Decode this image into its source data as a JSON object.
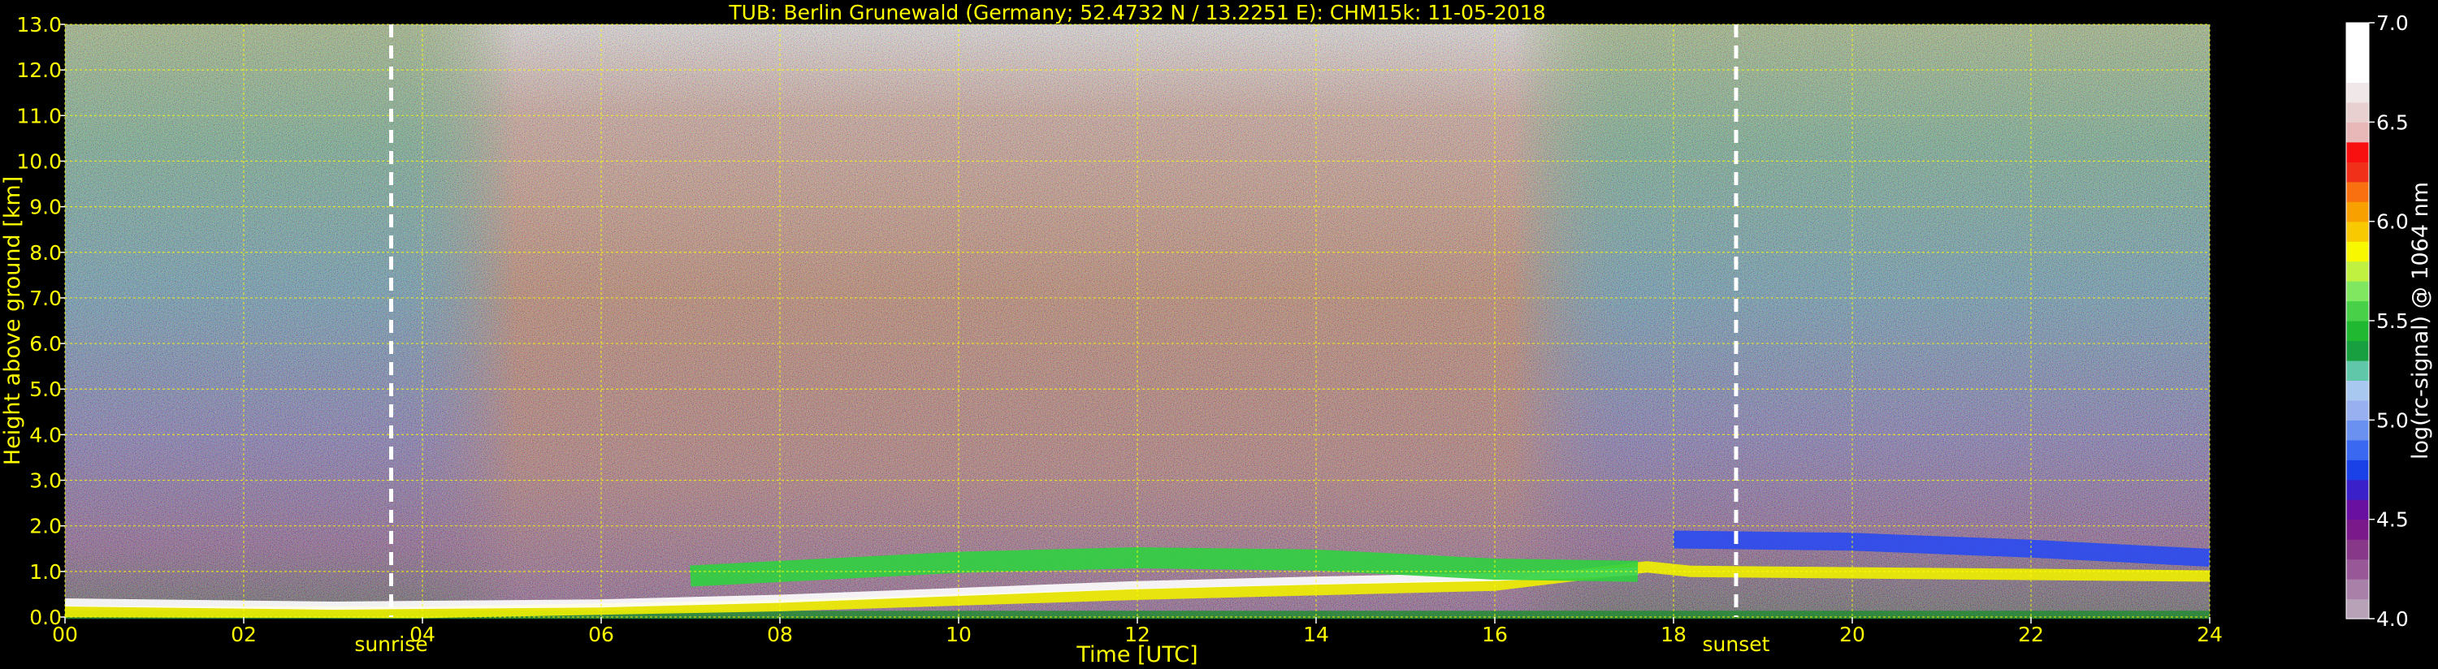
{
  "chart_data": {
    "type": "heatmap",
    "title": "TUB: Berlin Grunewald (Germany; 52.4732 N / 13.2251 E):    CHM15k: 11-05-2018",
    "xlabel": "Time [UTC]",
    "ylabel": "Height above ground [km]",
    "xlim": [
      0,
      24
    ],
    "ylim": [
      0,
      13
    ],
    "x_ticks": [
      "00",
      "02",
      "04",
      "06",
      "08",
      "10",
      "12",
      "14",
      "16",
      "18",
      "20",
      "22",
      "24"
    ],
    "y_ticks": [
      "0.0",
      "1.0",
      "2.0",
      "3.0",
      "4.0",
      "5.0",
      "6.0",
      "7.0",
      "8.0",
      "9.0",
      "10.0",
      "11.0",
      "12.0",
      "13.0"
    ],
    "grid": true,
    "grid_color": "#ffff00",
    "events": [
      {
        "name": "sunrise",
        "time": 3.65
      },
      {
        "name": "sunset",
        "time": 18.7
      }
    ],
    "colorbar": {
      "label": "log(rc-signal) @ 1064 nm",
      "range": [
        4.0,
        7.0
      ],
      "ticks": [
        "4.0",
        "4.5",
        "5.0",
        "5.5",
        "6.0",
        "6.5",
        "7.0"
      ],
      "colors": [
        "#b8a2b8",
        "#a880a8",
        "#985898",
        "#883888",
        "#7a1a8a",
        "#6a10a0",
        "#3a20c8",
        "#1a40e8",
        "#3a68f0",
        "#6a90f0",
        "#98b0f0",
        "#a8c8f0",
        "#60c8a8",
        "#18a040",
        "#20b830",
        "#48d048",
        "#80e860",
        "#c0f040",
        "#f8f800",
        "#f8c800",
        "#f8a000",
        "#f87010",
        "#f03018",
        "#f81010",
        "#e8b8b8",
        "#e8d0d0",
        "#f0e8e8",
        "#ffffff",
        "#ffffff",
        "#ffffff"
      ]
    },
    "layers": [
      {
        "name": "surface",
        "color": "#2a8a3a",
        "points": [
          [
            0,
            0.05
          ],
          [
            24,
            0.05
          ]
        ]
      },
      {
        "name": "aerosol-layer-top",
        "color": "#f0f000",
        "points": [
          [
            0,
            0.12
          ],
          [
            4,
            0.1
          ],
          [
            8,
            0.25
          ],
          [
            12,
            0.5
          ],
          [
            16,
            0.7
          ],
          [
            17.7,
            1.1
          ],
          [
            18.2,
            1.0
          ],
          [
            24,
            0.9
          ]
        ]
      },
      {
        "name": "boundary-layer-top",
        "color": "#ffffff",
        "points": [
          [
            0,
            0.32
          ],
          [
            3,
            0.25
          ],
          [
            6,
            0.3
          ],
          [
            8,
            0.4
          ],
          [
            10,
            0.55
          ],
          [
            12,
            0.7
          ],
          [
            14,
            0.8
          ],
          [
            16,
            0.88
          ],
          [
            17.6,
            1.0
          ]
        ]
      },
      {
        "name": "residual-layer",
        "color": "#30d040",
        "points": [
          [
            7,
            0.9
          ],
          [
            10,
            1.2
          ],
          [
            12,
            1.3
          ],
          [
            14,
            1.25
          ],
          [
            16,
            1.05
          ],
          [
            17.6,
            1.0
          ]
        ]
      },
      {
        "name": "evening-layer",
        "color": "#2a4af0",
        "points": [
          [
            18,
            1.7
          ],
          [
            20,
            1.65
          ],
          [
            22,
            1.5
          ],
          [
            24,
            1.3
          ]
        ]
      }
    ]
  }
}
